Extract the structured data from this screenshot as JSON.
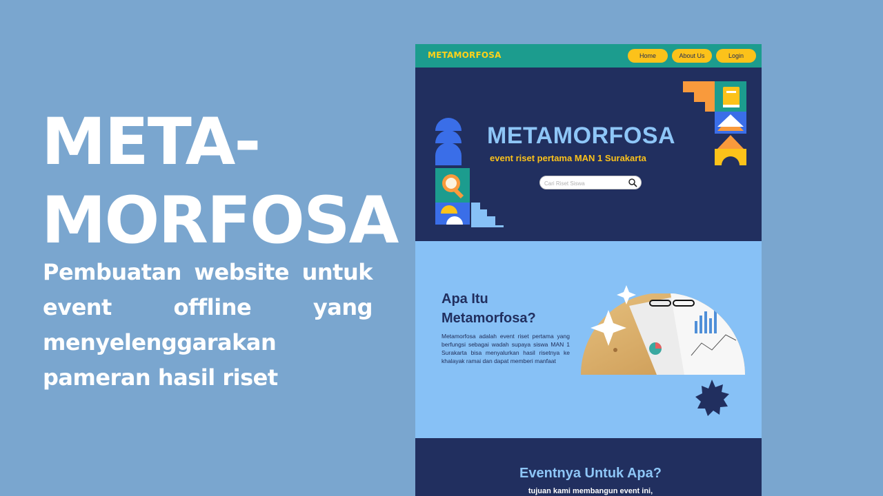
{
  "slide": {
    "title_lines": [
      "META-",
      "MORFOSA"
    ],
    "subtitle": "Pembuatan website untuk event offline yang menyelenggarakan pameran hasil riset"
  },
  "website": {
    "brand": "METAMORFOSA",
    "nav": [
      "Home",
      "About Us",
      "Login"
    ],
    "hero": {
      "title": "METAMORFOSA",
      "subtitle": "event riset pertama MAN 1 Surakarta",
      "search_placeholder": "Cari Riset Siswa"
    },
    "about": {
      "title": "Apa Itu Metamorfosa?",
      "text": "Metamorfosa adalah event riset pertama yang berfungsi sebagai wadah supaya siswa MAN 1 Surakarta bisa menyalurkan hasil risetnya ke khalayak ramai dan dapat memberi manfaat"
    },
    "event": {
      "title": "Eventnya Untuk Apa?",
      "subtitle": "tujuan kami membangun event ini,"
    }
  },
  "colors": {
    "slide_background": "#7aa6cf",
    "navy": "#212f5f",
    "teal": "#1c9c8e",
    "yellow": "#fcc21a",
    "light_blue": "#87c1f6",
    "orange": "#f99a3c",
    "blue": "#3a6ee8"
  },
  "icons": [
    "search-icon",
    "sparkle-icon",
    "star-badge-icon",
    "magnifier-icon",
    "book-icon"
  ]
}
